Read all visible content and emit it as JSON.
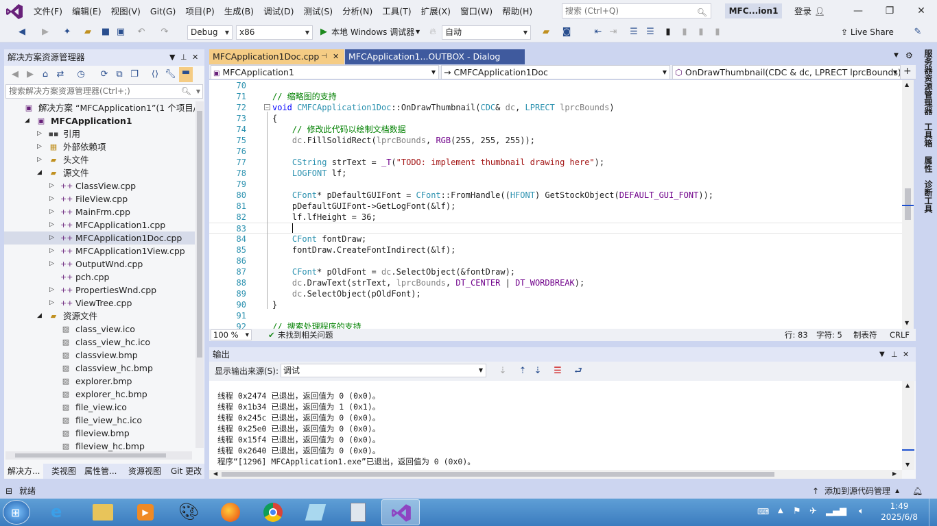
{
  "menubar": {
    "items": [
      "文件(F)",
      "编辑(E)",
      "视图(V)",
      "Git(G)",
      "项目(P)",
      "生成(B)",
      "调试(D)",
      "测试(S)",
      "分析(N)",
      "工具(T)",
      "扩展(X)",
      "窗口(W)",
      "帮助(H)"
    ],
    "search_placeholder": "搜索 (Ctrl+Q)",
    "solution_name": "MFC...ion1",
    "login": "登录"
  },
  "toolbar": {
    "config": "Debug",
    "platform": "x86",
    "run_label": "本地 Windows 调试器",
    "auto": "自动",
    "live_share": "Live Share"
  },
  "solution_explorer": {
    "title": "解决方案资源管理器",
    "search_placeholder": "搜索解决方案资源管理器(Ctrl+;)",
    "items": [
      {
        "label": "解决方案 “MFCApplication1”(1 个项目/共",
        "level": 0,
        "icon": "solution-icon",
        "expander": ""
      },
      {
        "label": "MFCApplication1",
        "level": 1,
        "icon": "project-icon",
        "expander": "◢",
        "bold": true
      },
      {
        "label": "引用",
        "level": 2,
        "icon": "references-icon",
        "expander": "▷"
      },
      {
        "label": "外部依赖项",
        "level": 2,
        "icon": "external-deps-icon",
        "expander": "▷"
      },
      {
        "label": "头文件",
        "level": 2,
        "icon": "folder-icon",
        "expander": "▷"
      },
      {
        "label": "源文件",
        "level": 2,
        "icon": "folder-icon",
        "expander": "◢"
      },
      {
        "label": "ClassView.cpp",
        "level": 3,
        "icon": "cpp-file-icon",
        "expander": "▷"
      },
      {
        "label": "FileView.cpp",
        "level": 3,
        "icon": "cpp-file-icon",
        "expander": "▷"
      },
      {
        "label": "MainFrm.cpp",
        "level": 3,
        "icon": "cpp-file-icon",
        "expander": "▷"
      },
      {
        "label": "MFCApplication1.cpp",
        "level": 3,
        "icon": "cpp-file-icon",
        "expander": "▷"
      },
      {
        "label": "MFCApplication1Doc.cpp",
        "level": 3,
        "icon": "cpp-file-icon",
        "expander": "▷",
        "selected": true
      },
      {
        "label": "MFCApplication1View.cpp",
        "level": 3,
        "icon": "cpp-file-icon",
        "expander": "▷"
      },
      {
        "label": "OutputWnd.cpp",
        "level": 3,
        "icon": "cpp-file-icon",
        "expander": "▷"
      },
      {
        "label": "pch.cpp",
        "level": 3,
        "icon": "cpp-file-icon",
        "expander": ""
      },
      {
        "label": "PropertiesWnd.cpp",
        "level": 3,
        "icon": "cpp-file-icon",
        "expander": "▷"
      },
      {
        "label": "ViewTree.cpp",
        "level": 3,
        "icon": "cpp-file-icon",
        "expander": "▷"
      },
      {
        "label": "资源文件",
        "level": 2,
        "icon": "folder-icon",
        "expander": "◢"
      },
      {
        "label": "class_view.ico",
        "level": 3,
        "icon": "image-file-icon",
        "expander": ""
      },
      {
        "label": "class_view_hc.ico",
        "level": 3,
        "icon": "image-file-icon",
        "expander": ""
      },
      {
        "label": "classview.bmp",
        "level": 3,
        "icon": "image-file-icon",
        "expander": ""
      },
      {
        "label": "classview_hc.bmp",
        "level": 3,
        "icon": "image-file-icon",
        "expander": ""
      },
      {
        "label": "explorer.bmp",
        "level": 3,
        "icon": "image-file-icon",
        "expander": ""
      },
      {
        "label": "explorer_hc.bmp",
        "level": 3,
        "icon": "image-file-icon",
        "expander": ""
      },
      {
        "label": "file_view.ico",
        "level": 3,
        "icon": "image-file-icon",
        "expander": ""
      },
      {
        "label": "file_view_hc.ico",
        "level": 3,
        "icon": "image-file-icon",
        "expander": ""
      },
      {
        "label": "fileview.bmp",
        "level": 3,
        "icon": "image-file-icon",
        "expander": ""
      },
      {
        "label": "fileview_hc.bmp",
        "level": 3,
        "icon": "image-file-icon",
        "expander": ""
      }
    ],
    "tabs": [
      "解决方... ",
      "类视图",
      "属性管...",
      "资源视图",
      "Git 更改"
    ]
  },
  "editor": {
    "tabs": [
      {
        "label": "MFCApplication1Doc.cpp",
        "active": true
      },
      {
        "label": "MFCApplication1...OUTBOX - Dialog",
        "active": false
      }
    ],
    "nav": {
      "project": "MFCApplication1",
      "class": "CMFCApplication1Doc",
      "member": "OnDrawThumbnail(CDC & dc, LPRECT lprcBounds)"
    },
    "lines": [
      {
        "n": "70",
        "t": ""
      },
      {
        "n": "71",
        "t": "// 缩略图的支持",
        "cls": "c-comment"
      },
      {
        "n": "72",
        "t": "void CMFCApplication1Doc::OnDrawThumbnail(CDC& dc, LPRECT lprcBounds)"
      },
      {
        "n": "73",
        "t": "{"
      },
      {
        "n": "74",
        "t": "    // 修改此代码以绘制文档数据",
        "cls": "c-comment"
      },
      {
        "n": "75",
        "t": "    dc.FillSolidRect(lprcBounds, RGB(255, 255, 255));"
      },
      {
        "n": "76",
        "t": ""
      },
      {
        "n": "77",
        "t": "    CString strText = _T(\"TODO: implement thumbnail drawing here\");"
      },
      {
        "n": "78",
        "t": "    LOGFONT lf;"
      },
      {
        "n": "79",
        "t": ""
      },
      {
        "n": "80",
        "t": "    CFont* pDefaultGUIFont = CFont::FromHandle((HFONT) GetStockObject(DEFAULT_GUI_FONT));"
      },
      {
        "n": "81",
        "t": "    pDefaultGUIFont->GetLogFont(&lf);"
      },
      {
        "n": "82",
        "t": "    lf.lfHeight = 36;"
      },
      {
        "n": "83",
        "t": "    ",
        "current": true
      },
      {
        "n": "84",
        "t": "    CFont fontDraw;"
      },
      {
        "n": "85",
        "t": "    fontDraw.CreateFontIndirect(&lf);"
      },
      {
        "n": "86",
        "t": ""
      },
      {
        "n": "87",
        "t": "    CFont* pOldFont = dc.SelectObject(&fontDraw);"
      },
      {
        "n": "88",
        "t": "    dc.DrawText(strText, lprcBounds, DT_CENTER | DT_WORDBREAK);"
      },
      {
        "n": "89",
        "t": "    dc.SelectObject(pOldFont);"
      },
      {
        "n": "90",
        "t": "}"
      },
      {
        "n": "91",
        "t": ""
      },
      {
        "n": "92",
        "t": "// 搜索处理程序的支持",
        "cls": "c-comment"
      }
    ],
    "status": {
      "zoom": "100 %",
      "issues": "未找到相关问题",
      "line": "行: 83",
      "col": "字符: 5",
      "tabs": "制表符",
      "eol": "CRLF"
    }
  },
  "output": {
    "title": "输出",
    "source_label": "显示输出来源(S):",
    "source_value": "调试",
    "lines": [
      "线程 0x2474 已退出，返回值为 0 (0x0)。",
      "线程 0x1b34 已退出，返回值为 1 (0x1)。",
      "线程 0x245c 已退出，返回值为 0 (0x0)。",
      "线程 0x25e0 已退出，返回值为 0 (0x0)。",
      "线程 0x15f4 已退出，返回值为 0 (0x0)。",
      "线程 0x2640 已退出，返回值为 0 (0x0)。",
      "程序“[1296] MFCApplication1.exe”已退出，返回值为 0 (0x0)。"
    ]
  },
  "right_dock": [
    "服务器资源管理器",
    "工具箱",
    "属性",
    "诊断工具"
  ],
  "statusbar": {
    "ready": "就绪",
    "source_control": "添加到源代码管理"
  },
  "taskbar": {
    "time": "1:49",
    "date": "2025/6/8"
  }
}
